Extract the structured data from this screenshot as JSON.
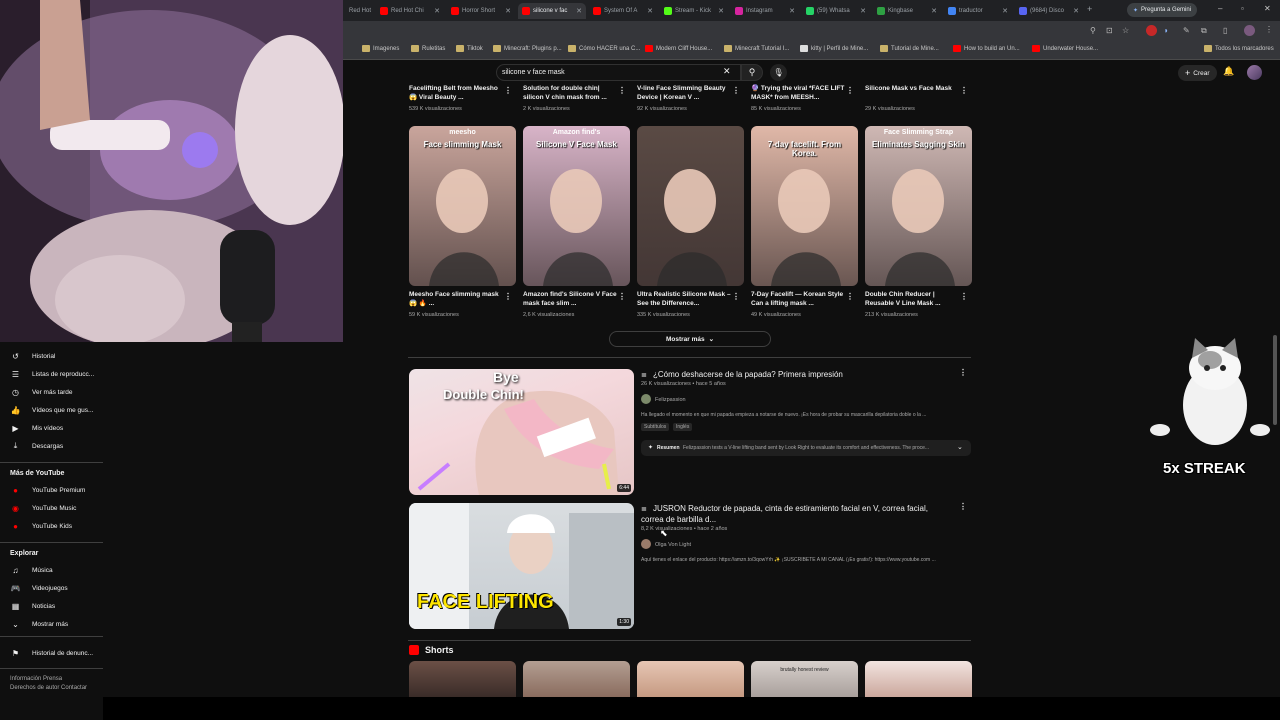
{
  "browser": {
    "tabs": [
      "Red Hot Chi",
      "Horror Short",
      "silicone v fac",
      "System Of A",
      "Stream - Kick",
      "Instagram",
      "(59) Whatsa",
      "Kingbase",
      "traductor",
      "(9684) Disco"
    ],
    "gemini_label": "Pregunta a Gemini",
    "bookmarks": [
      "Imagenes",
      "Ruletitas",
      "Tiktok",
      "Minecraft: Plugins p...",
      "Cómo HACER una C...",
      "Modern Cliff House...",
      "Minecraft Tutorial I...",
      "kitty | Perfil de Mine...",
      "Tutorial de Mine...",
      "How to build an Un...",
      "Underwater House..."
    ],
    "all_bookmarks": "Todos los marcadores"
  },
  "header": {
    "search_value": "silicone v face mask",
    "create_label": "Crear"
  },
  "top_row": [
    {
      "title": "Facelifting Belt from Meesho 😱 Viral Beauty ...",
      "views": "539 K visualizaciones"
    },
    {
      "title": "Solution for double chin| silicon V chin mask from ...",
      "views": "2 K visualizaciones"
    },
    {
      "title": "V-line Face Slimming Beauty Device | Korean V ...",
      "views": "92 K visualizaciones"
    },
    {
      "title": "🔮 Trying the viral *FACE LIFT MASK* from MEESH...",
      "views": "85 K visualizaciones"
    },
    {
      "title": "Silicone Mask vs Face Mask",
      "views": "29 K visualizaciones"
    }
  ],
  "shorts_row": [
    {
      "title": "Meesho Face slimming mask 😱 🔥 ...",
      "views": "59 K visualizaciones",
      "overlay_top": "meesho",
      "overlay_text": "Face slimming Mask",
      "color": "#c9a59c"
    },
    {
      "title": "Amazon find's Silicone V Face mask face slim ...",
      "views": "2,6 K visualizaciones",
      "overlay_top": "Amazon find's",
      "overlay_text": "Silicone V Face Mask",
      "color": "#d8b4c8"
    },
    {
      "title": "Ultra Realistic Silicone Mask – See the Difference...",
      "views": "335 K visualizaciones",
      "overlay_top": "",
      "overlay_text": "",
      "color": "#5a4a44"
    },
    {
      "title": "7-Day Facelift — Korean Style Can a lifting mask ...",
      "views": "49 K visualizaciones",
      "overlay_top": "",
      "overlay_text": "7-day facelift. From Korea.",
      "color": "#e0b8a8"
    },
    {
      "title": "Double Chin Reducer | Reusable V Line Mask ...",
      "views": "213 K visualizaciones",
      "overlay_top": "Face Slimming Strap",
      "overlay_text": "Eliminates Sagging Skin",
      "color": "#cfb8b4"
    }
  ],
  "show_more": "Mostrar más",
  "videos": [
    {
      "title": "¿Cómo deshacerse de la papada? Primera impresión",
      "meta": "26 K visualizaciones • hace 5 años",
      "channel": "Felizpassion",
      "desc": "Ha llegado el momento en que mi papada empieza a notarse de nuevo. ¡Es hora de probar su mascarilla depilatoria doble o la ...",
      "badges": [
        "Subtítulos",
        "Inglés"
      ],
      "summary_label": "Resumen",
      "summary": "Felizpassion tests a V-line lifting band sent by Look Right to evaluate its comfort and effectiveness. The proce...",
      "duration": "6:44",
      "thumb_text_top": "Bye",
      "thumb_text": "Double Chin!"
    },
    {
      "title": "JUSRON Reductor de papada, cinta de estiramiento facial en V, correa facial, correa de barbilla d...",
      "meta": "8,2 K visualizaciones • hace 2 años",
      "channel": "Olga Von Light",
      "desc": "Aquí tienes el enlace del producto: https://amzn.to/3qowYrh ✨ ¡SUSCRÍBETE A MI CANAL (¡Es gratis!): https://www.youtube.com ...",
      "duration": "1:30",
      "thumb_text": "FACE LIFTING"
    }
  ],
  "shorts_section": {
    "title": "Shorts",
    "bottom_thumb_text": "brutally honest review"
  },
  "sidebar": {
    "items": [
      {
        "icon": "↺",
        "label": "Historial"
      },
      {
        "icon": "☰",
        "label": "Listas de reproducc..."
      },
      {
        "icon": "◷",
        "label": "Ver más tarde"
      },
      {
        "icon": "👍",
        "label": "Vídeos que me gus..."
      },
      {
        "icon": "▶",
        "label": "Mis vídeos"
      },
      {
        "icon": "⤓",
        "label": "Descargas"
      }
    ],
    "more_title": "Más de YouTube",
    "more": [
      "YouTube Premium",
      "YouTube Music",
      "YouTube Kids"
    ],
    "explore_title": "Explorar",
    "explore": [
      {
        "icon": "♫",
        "label": "Música"
      },
      {
        "icon": "🎮",
        "label": "Videojuegos"
      },
      {
        "icon": "▦",
        "label": "Noticias"
      },
      {
        "icon": "⌄",
        "label": "Mostrar más"
      }
    ],
    "report": "Historial de denunc...",
    "footer1": "Información  Prensa",
    "footer2": "Derechos de autor  Contactar"
  },
  "overlay": {
    "streak": "5x STREAK"
  }
}
